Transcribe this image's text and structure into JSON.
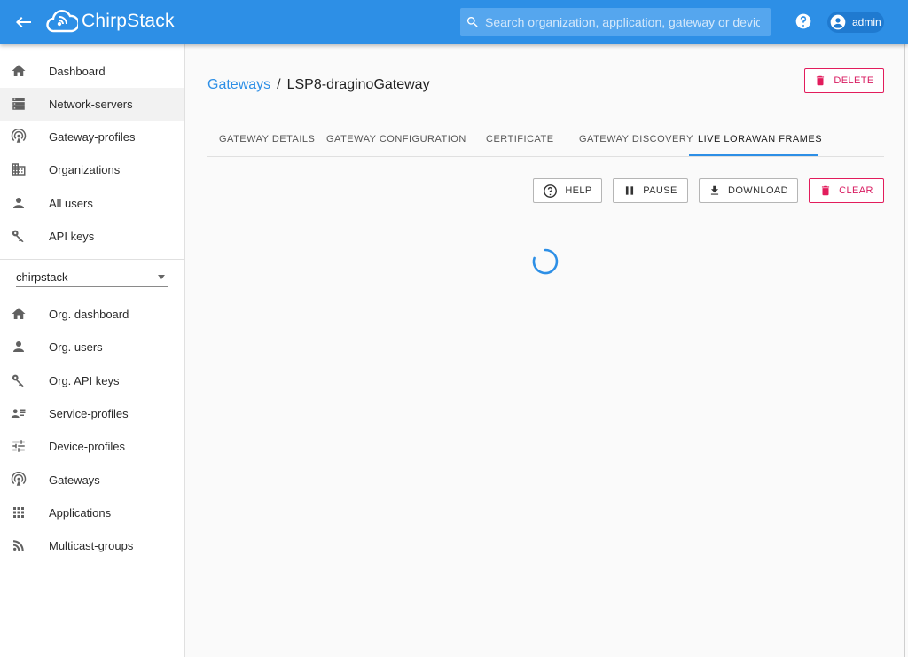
{
  "header": {
    "app_name": "ChirpStack",
    "search_placeholder": "Search organization, application, gateway or device",
    "user": "admin"
  },
  "sidebar": {
    "global_items": [
      {
        "label": "Dashboard",
        "icon": "home-icon"
      },
      {
        "label": "Network-servers",
        "icon": "server-icon",
        "active": true
      },
      {
        "label": "Gateway-profiles",
        "icon": "access-point-icon"
      },
      {
        "label": "Organizations",
        "icon": "domain-icon"
      },
      {
        "label": "All users",
        "icon": "person-icon"
      },
      {
        "label": "API keys",
        "icon": "key-icon"
      }
    ],
    "organization_select": "chirpstack",
    "org_items": [
      {
        "label": "Org. dashboard",
        "icon": "home-icon"
      },
      {
        "label": "Org. users",
        "icon": "person-icon"
      },
      {
        "label": "Org. API keys",
        "icon": "key-icon"
      },
      {
        "label": "Service-profiles",
        "icon": "account-details-icon"
      },
      {
        "label": "Device-profiles",
        "icon": "tune-icon"
      },
      {
        "label": "Gateways",
        "icon": "access-point-icon"
      },
      {
        "label": "Applications",
        "icon": "apps-icon"
      },
      {
        "label": "Multicast-groups",
        "icon": "rss-icon"
      }
    ]
  },
  "breadcrumb": {
    "parent": "Gateways",
    "separator": "/",
    "current": "LSP8-draginoGateway"
  },
  "actions": {
    "delete_label": "DELETE"
  },
  "tabs": [
    {
      "label": "GATEWAY DETAILS"
    },
    {
      "label": "GATEWAY CONFIGURATION"
    },
    {
      "label": "CERTIFICATE"
    },
    {
      "label": "GATEWAY DISCOVERY"
    },
    {
      "label": "LIVE LORAWAN FRAMES",
      "active": true
    }
  ],
  "frames_toolbar": {
    "help_label": "HELP",
    "pause_label": "PAUSE",
    "download_label": "DOWNLOAD",
    "clear_label": "CLEAR"
  },
  "colors": {
    "primary": "#2d8fe6",
    "danger": "#d81b60"
  }
}
